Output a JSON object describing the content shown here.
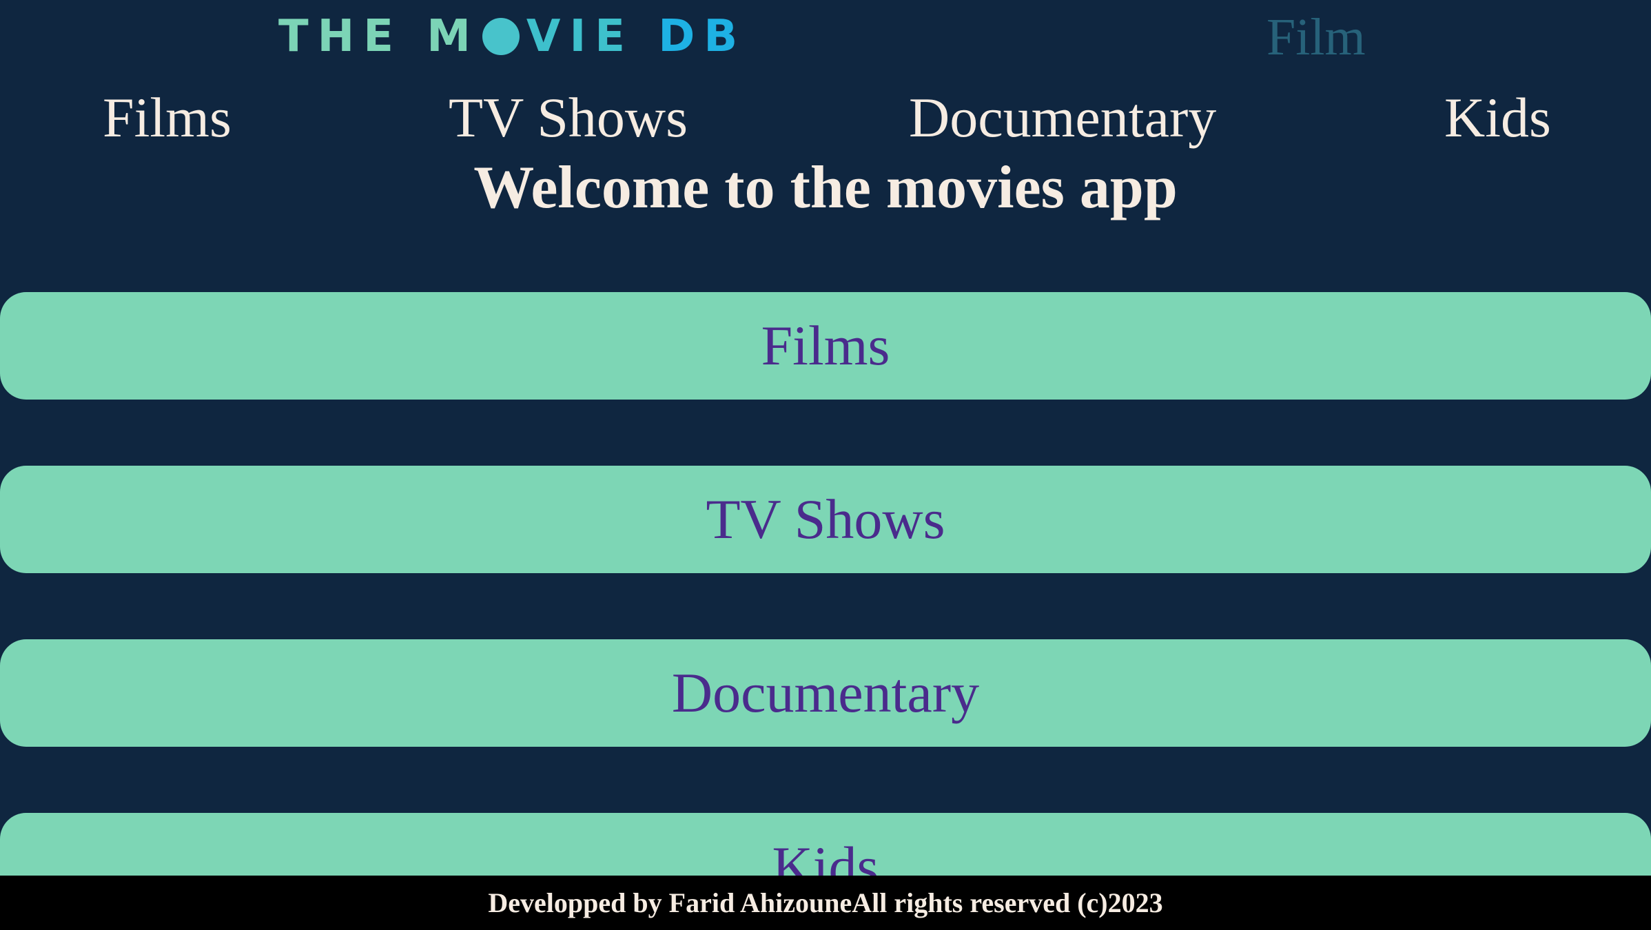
{
  "header": {
    "logo": {
      "part1": "THE M",
      "part2": "VIE",
      "part3": "DB",
      "colors": [
        "#7cd4b6",
        "#3ec0cc",
        "#1eb1e4"
      ]
    },
    "search": {
      "placeholder": "Film"
    }
  },
  "nav": {
    "items": [
      {
        "label": "Films"
      },
      {
        "label": "TV Shows"
      },
      {
        "label": "Documentary"
      },
      {
        "label": "Kids"
      }
    ]
  },
  "main": {
    "welcome": "Welcome to the movies app",
    "categories": [
      {
        "label": "Films"
      },
      {
        "label": "TV Shows"
      },
      {
        "label": "Documentary"
      },
      {
        "label": "Kids"
      }
    ]
  },
  "footer": {
    "text": "Developped by Farid AhizouneAll rights reserved (c)2023"
  },
  "colors": {
    "background": "#0f2640",
    "button": "#7dd6b5",
    "button_text": "#4a2b8c",
    "text": "#f6ece2",
    "footer_bg": "#000000"
  }
}
